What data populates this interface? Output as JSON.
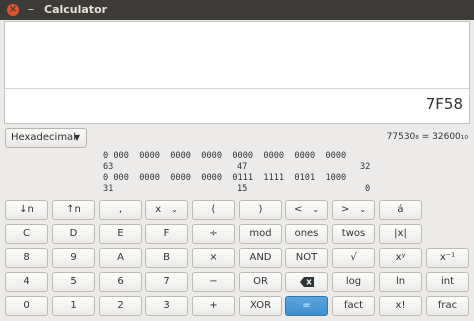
{
  "window": {
    "title": "Calculator",
    "close_glyph": "×",
    "minimize_glyph": "–"
  },
  "display": {
    "expression": "",
    "result": "7F58"
  },
  "controls": {
    "base_label": "Hexadecimal",
    "conversion_text": "77530₈ = 32600₁₀"
  },
  "bits": {
    "row1": "0 000  0000  0000  0000  0000  0000  0000  0000",
    "row1_indices": [
      "63",
      "47",
      "32"
    ],
    "row2": "0 000  0000  0000  0000  0111  1111  0101  1000",
    "row2_indices": [
      "31",
      "15",
      "0"
    ]
  },
  "keypad": {
    "row1": [
      "↓n",
      "↑n",
      ",",
      "x",
      "(",
      ")",
      "<",
      ">",
      "á"
    ],
    "row2": [
      "C",
      "D",
      "E",
      "F",
      "÷",
      "mod",
      "ones",
      "twos",
      "|x|"
    ],
    "row3": [
      "8",
      "9",
      "A",
      "B",
      "×",
      "AND",
      "NOT",
      "√",
      "xʸ",
      "x⁻¹"
    ],
    "row4": [
      "4",
      "5",
      "6",
      "7",
      "−",
      "OR",
      "⌫",
      "log",
      "ln",
      "int"
    ],
    "row5": [
      "0",
      "1",
      "2",
      "3",
      "+",
      "XOR",
      "=",
      "fact",
      "x!",
      "frac"
    ],
    "dropdown_glyph": "⌄",
    "backspace_icon": "backspace-icon"
  },
  "colors": {
    "accent": "#4a9ad8",
    "titlebar": "#3c3b37",
    "close": "#e2552c"
  }
}
